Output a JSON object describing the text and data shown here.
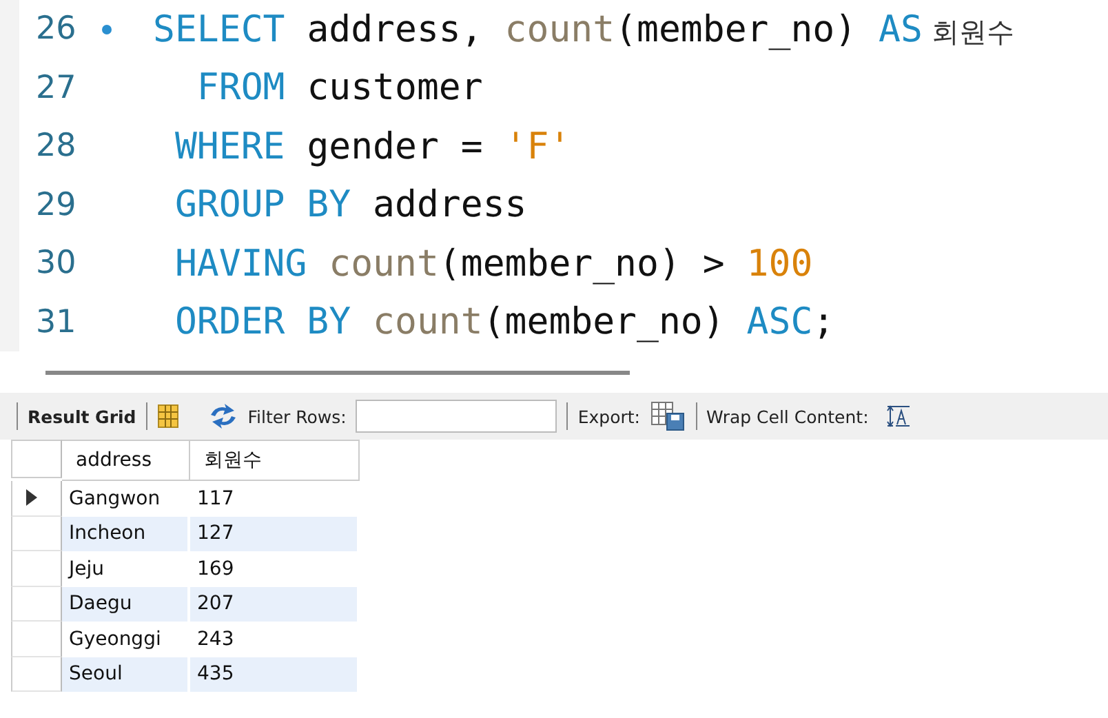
{
  "editor": {
    "lines": [
      {
        "number": "26",
        "marker": true,
        "tokens": [
          {
            "kind": "keyword",
            "text": "SELECT"
          },
          {
            "kind": "plain",
            "text": " address, "
          },
          {
            "kind": "function",
            "text": "count"
          },
          {
            "kind": "plain",
            "text": "(member_no) "
          },
          {
            "kind": "keyword",
            "text": "AS"
          },
          {
            "kind": "alias",
            "text": " 회원수"
          }
        ]
      },
      {
        "number": "27",
        "marker": false,
        "tokens": [
          {
            "kind": "keyword",
            "text": "  FROM"
          },
          {
            "kind": "plain",
            "text": " customer"
          }
        ]
      },
      {
        "number": "28",
        "marker": false,
        "tokens": [
          {
            "kind": "keyword",
            "text": " WHERE"
          },
          {
            "kind": "plain",
            "text": " gender = "
          },
          {
            "kind": "string",
            "text": "'F'"
          }
        ]
      },
      {
        "number": "29",
        "marker": false,
        "tokens": [
          {
            "kind": "keyword",
            "text": " GROUP BY"
          },
          {
            "kind": "plain",
            "text": " address"
          }
        ]
      },
      {
        "number": "30",
        "marker": false,
        "tokens": [
          {
            "kind": "keyword",
            "text": " HAVING"
          },
          {
            "kind": "function",
            "text": " count"
          },
          {
            "kind": "plain",
            "text": "(member_no) > "
          },
          {
            "kind": "number",
            "text": "100"
          }
        ]
      },
      {
        "number": "31",
        "marker": false,
        "tokens": [
          {
            "kind": "keyword",
            "text": " ORDER BY"
          },
          {
            "kind": "function",
            "text": " count"
          },
          {
            "kind": "plain",
            "text": "(member_no) "
          },
          {
            "kind": "keyword",
            "text": "ASC"
          },
          {
            "kind": "plain",
            "text": ";"
          }
        ]
      }
    ]
  },
  "toolbar": {
    "result_grid": "Result Grid",
    "filter_label": "Filter Rows:",
    "export_label": "Export:",
    "wrap_label": "Wrap Cell Content:"
  },
  "table": {
    "columns": [
      "address",
      "회원수"
    ],
    "rows": [
      {
        "address": "Gangwon",
        "count": "117",
        "selected": true
      },
      {
        "address": "Incheon",
        "count": "127",
        "selected": false
      },
      {
        "address": "Jeju",
        "count": "169",
        "selected": false
      },
      {
        "address": "Daegu",
        "count": "207",
        "selected": false
      },
      {
        "address": "Gyeonggi",
        "count": "243",
        "selected": false
      },
      {
        "address": "Seoul",
        "count": "435",
        "selected": false
      }
    ]
  }
}
